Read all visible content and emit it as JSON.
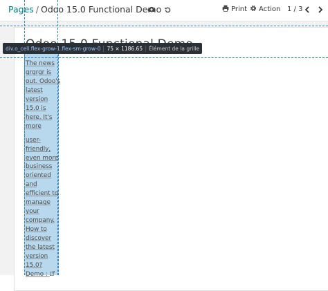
{
  "control_panel": {
    "breadcrumb": {
      "parent": "Pages",
      "separator": "/",
      "current": "Odoo 15.0 Functional Demo"
    },
    "print_label": "Print",
    "action_label": "Action",
    "pager": "1 / 3"
  },
  "page": {
    "title": "Odoo 15.0 Functional Demo"
  },
  "inspector": {
    "selector": "div.o_cell.flex-grow-1.flex-sm-grow-0",
    "dimensions": "75 × 1186.65",
    "role": "Élément de la grille"
  },
  "content": {
    "lines_1": [
      "The news",
      "grgrgr is",
      "out. Odoo's",
      "latest",
      "version",
      "15.0 is",
      "here. It's",
      "more"
    ],
    "lines_2": [
      "user-",
      "friendly,",
      "even more",
      "business",
      "oriented",
      "and",
      "efficient to",
      "manage",
      "your",
      "company.",
      "How to",
      "discover",
      "the latest",
      "version",
      "15.0?",
      "Demo :"
    ]
  },
  "colors": {
    "accent": "#017e84",
    "highlight": "#61aad6",
    "tooltip_bg": "#2b2f36"
  },
  "icons": [
    "cloud-upload-icon",
    "undo-icon",
    "print-icon",
    "gear-icon",
    "chevron-left-icon",
    "chevron-right-icon",
    "external-link-icon"
  ]
}
